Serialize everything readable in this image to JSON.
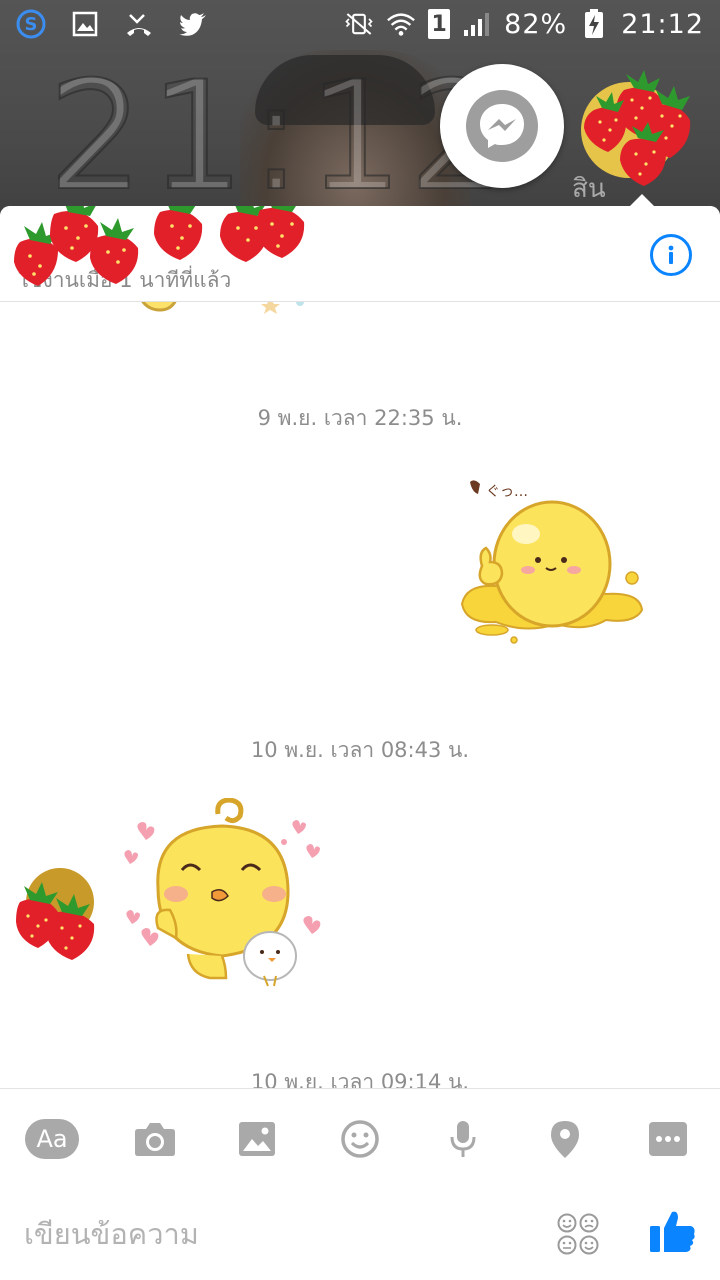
{
  "statusbar": {
    "icons_left": [
      "skype-icon",
      "image-icon",
      "missed-call-icon",
      "twitter-icon"
    ],
    "icons_right": [
      "vibrate-icon",
      "wifi-icon",
      "sim-icon",
      "signal-icon",
      "battery-icon"
    ],
    "sim_label": "1",
    "battery": "82%",
    "time": "21:12"
  },
  "lockscreen": {
    "clock": "21:12",
    "sub_text": "สิน"
  },
  "chat_header": {
    "contact_name": "",
    "active_status": "ใช้งานเมื่อ 1 นาทีที่แล้ว"
  },
  "messages": [
    {
      "type": "timestamp",
      "text": "9 พ.ย. เวลา 22:35 น."
    },
    {
      "type": "sticker",
      "side": "right",
      "name": "yellow-blob-thumbs-up"
    },
    {
      "type": "timestamp",
      "text": "10 พ.ย. เวลา 08:43 น."
    },
    {
      "type": "sticker",
      "side": "left",
      "name": "yellow-chick-hearts"
    },
    {
      "type": "timestamp",
      "text": "10 พ.ย. เวลา 09:14 น."
    }
  ],
  "composer": {
    "aa_label": "Aa",
    "placeholder": "เขียนข้อความ",
    "tools": [
      "text-format",
      "camera",
      "gallery",
      "emoji",
      "microphone",
      "location",
      "more"
    ]
  },
  "colors": {
    "accent": "#0b84ff",
    "toolbar_icon": "#a9a9a9",
    "timestamp": "#8d8d8d"
  }
}
